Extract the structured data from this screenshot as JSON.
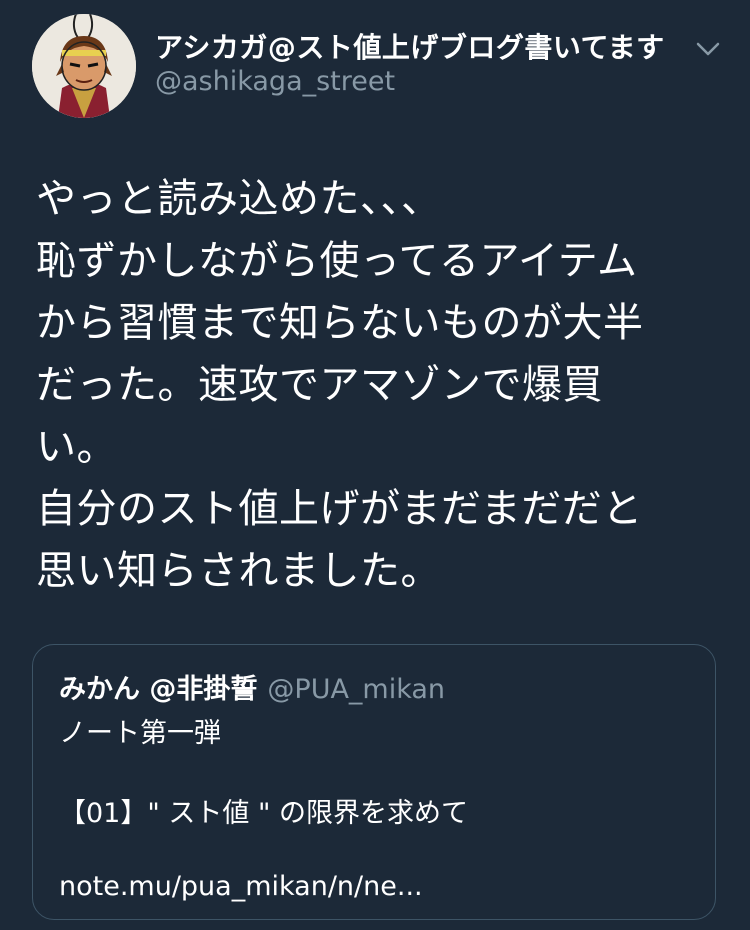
{
  "tweet": {
    "author": {
      "display_name": "アシカガ@スト値上げブログ書いてます",
      "handle": "@ashikaga_street",
      "avatar_icon": "avatar-samurai-keychain"
    },
    "menu_icon": "chevron-down-icon",
    "text_lines": [
      "やっと読み込めた、、、",
      "恥ずかしながら使ってるアイテム",
      "から習慣まで知らないものが大半",
      "だった。速攻でアマゾンで爆買",
      "い。",
      "自分のスト値上げがまだまだだと",
      "思い知らされました。"
    ]
  },
  "quoted_tweet": {
    "display_name": "みかん @非掛誓",
    "handle": "@PUA_mikan",
    "line1": "ノート第一弾",
    "line2": "【01】\" スト値 \" の限界を求めて",
    "link": "note.mu/pua_mikan/n/ne..."
  },
  "colors": {
    "background": "#1c2938",
    "text_primary": "#ffffff",
    "text_secondary": "#8899a6",
    "card_border": "#3d5466"
  }
}
